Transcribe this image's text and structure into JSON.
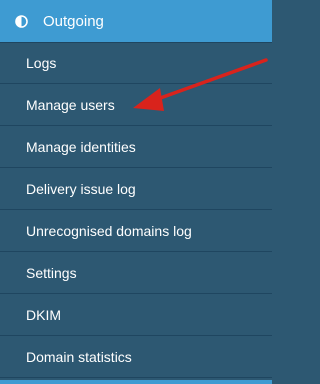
{
  "section": {
    "label": "Outgoing",
    "icon": "half-circle-icon"
  },
  "menu": {
    "items": [
      {
        "label": "Logs"
      },
      {
        "label": "Manage users"
      },
      {
        "label": "Manage identities"
      },
      {
        "label": "Delivery issue log"
      },
      {
        "label": "Unrecognised domains log"
      },
      {
        "label": "Settings"
      },
      {
        "label": "DKIM"
      },
      {
        "label": "Domain statistics"
      }
    ]
  },
  "colors": {
    "header_bg": "#3e9bd2",
    "menu_bg": "#2d5872",
    "annotation_arrow": "#d9231c"
  }
}
